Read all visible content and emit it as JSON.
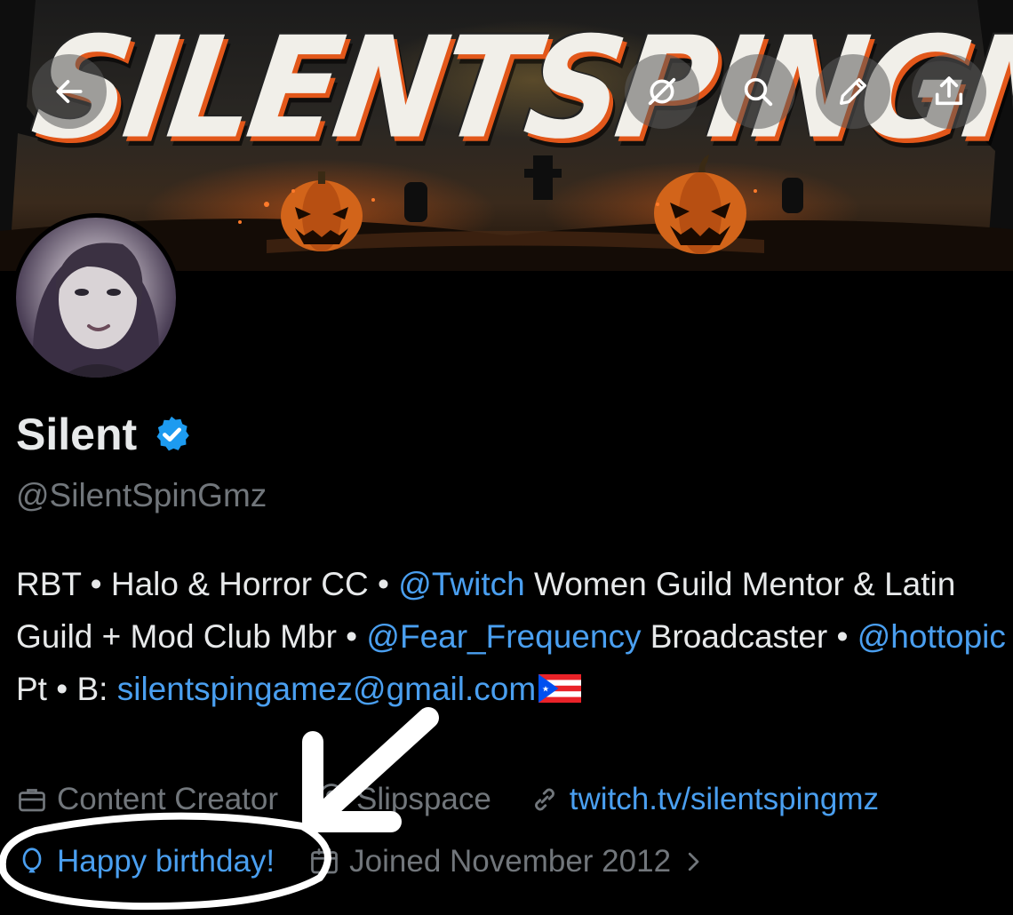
{
  "banner": {
    "title": "SILENTSPINGMZ",
    "icons": [
      "back-arrow-icon",
      "tracking-icon",
      "search-icon",
      "pencil-icon",
      "share-icon"
    ]
  },
  "profile": {
    "display_name": "Silent",
    "handle": "@SilentSpinGmz",
    "bio": {
      "part1": "RBT • Halo & Horror CC • ",
      "mention1": "@Twitch",
      "part2": " Women Guild Mentor & Latin Guild + Mod Club Mbr • ",
      "mention2": "@Fear_Frequency",
      "part3": " Broadcaster • ",
      "mention3": "@hottopic",
      "part4": " Pt • B: ",
      "email": "silentspingamez@gmail.com"
    },
    "meta": {
      "category": "Content Creator",
      "location": "Slipspace",
      "website": "twitch.tv/silentspingmz",
      "birthday": "Happy birthday!",
      "joined": "Joined November 2012"
    }
  },
  "colors": {
    "background": "#000000",
    "link": "#4a9ff0",
    "muted": "#71767b",
    "verified": "#1d9bf0",
    "banner_accent": "#e2571a"
  }
}
